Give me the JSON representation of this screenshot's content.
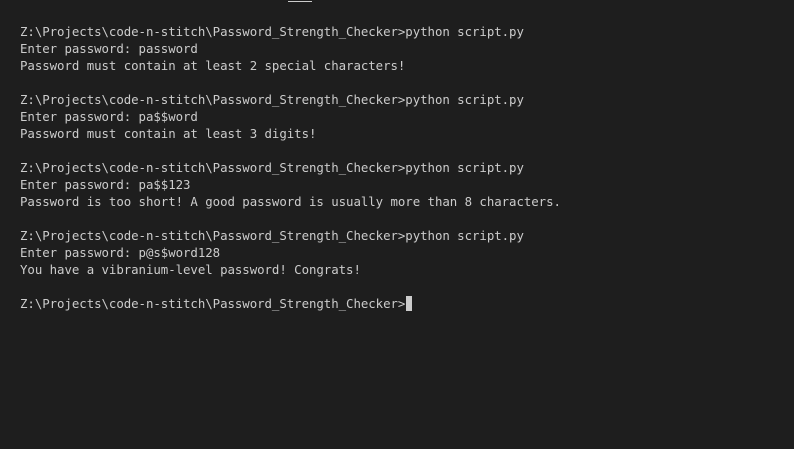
{
  "terminal": {
    "runs": [
      {
        "prompt": "Z:\\Projects\\code-n-stitch\\Password_Strength_Checker>python script.py",
        "input": "Enter password: password",
        "output": "Password must contain at least 2 special characters!"
      },
      {
        "prompt": "Z:\\Projects\\code-n-stitch\\Password_Strength_Checker>python script.py",
        "input": "Enter password: pa$$word",
        "output": "Password must contain at least 3 digits!"
      },
      {
        "prompt": "Z:\\Projects\\code-n-stitch\\Password_Strength_Checker>python script.py",
        "input": "Enter password: pa$$123",
        "output": "Password is too short! A good password is usually more than 8 characters."
      },
      {
        "prompt": "Z:\\Projects\\code-n-stitch\\Password_Strength_Checker>python script.py",
        "input": "Enter password: p@s$word128",
        "output": "You have a vibranium-level password! Congrats!"
      }
    ],
    "current_prompt": "Z:\\Projects\\code-n-stitch\\Password_Strength_Checker>"
  }
}
